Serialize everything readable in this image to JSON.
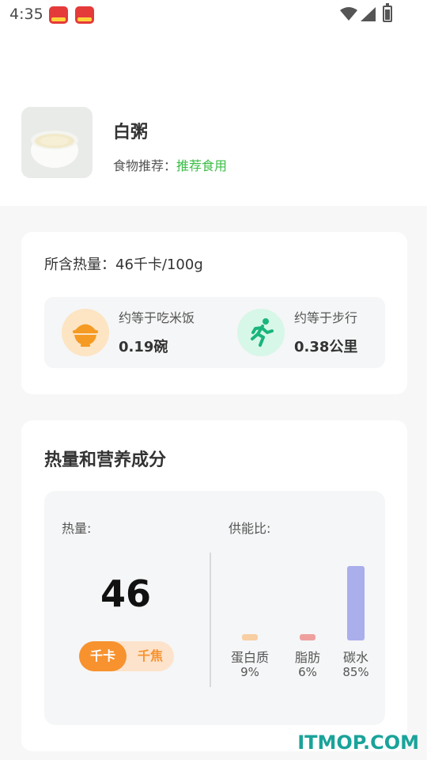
{
  "status_bar": {
    "time": "4:35"
  },
  "food": {
    "name": "白粥",
    "recommend_label": "食物推荐：",
    "recommend_value": "推荐食用"
  },
  "calorie_card": {
    "calorie_line": "所含热量：46千卡/100g",
    "rice": {
      "label": "约等于吃米饭",
      "value": "0.19碗"
    },
    "walk": {
      "label": "约等于步行",
      "value": "0.38公里"
    }
  },
  "nutrition": {
    "title": "热量和营养成分",
    "heat_label": "热量:",
    "heat_value": "46",
    "unit_active": "千卡",
    "unit_inactive": "千焦",
    "ratio_label": "供能比:"
  },
  "chart_data": {
    "type": "bar",
    "categories": [
      "蛋白质",
      "脂肪",
      "碳水"
    ],
    "values": [
      9,
      6,
      85
    ],
    "value_labels": [
      "9%",
      "6%",
      "85%"
    ],
    "colors": [
      "#f7cfa3",
      "#eea09f",
      "#aaaeeb"
    ],
    "ylim": [
      0,
      85
    ]
  },
  "watermark": "ITMOP.COM"
}
